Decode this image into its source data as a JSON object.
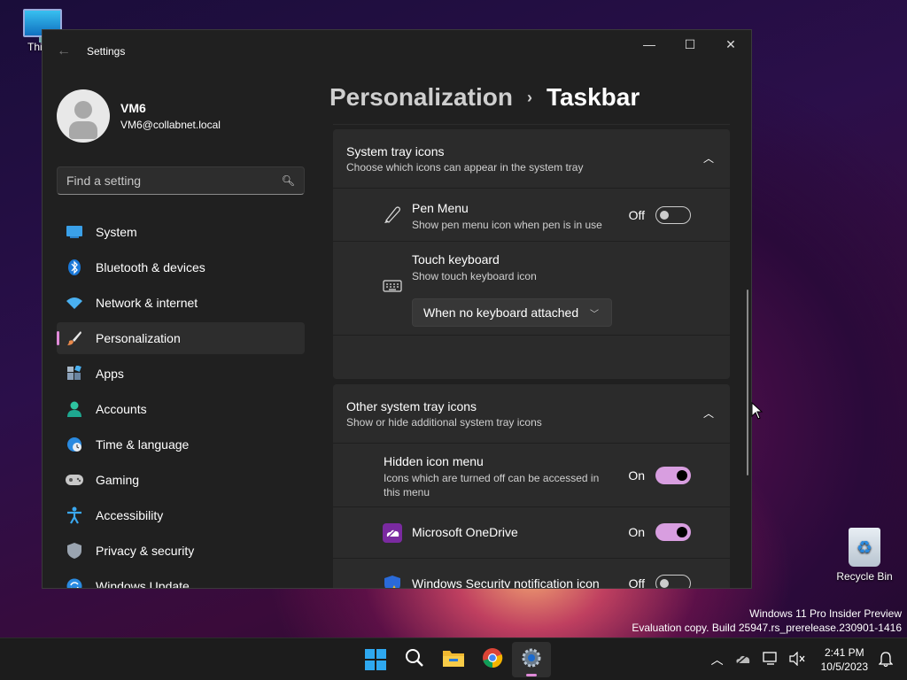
{
  "desktop": {
    "this_pc_label": "This P",
    "recycle_bin_label": "Recycle Bin",
    "watermark_line1": "Windows 11 Pro Insider Preview",
    "watermark_line2": "Evaluation copy. Build 25947.rs_prerelease.230901-1416"
  },
  "window": {
    "title": "Settings",
    "controls": {
      "minimize": "—",
      "maximize": "☐",
      "close": "✕"
    }
  },
  "profile": {
    "name": "VM6",
    "email": "VM6@collabnet.local"
  },
  "search": {
    "placeholder": "Find a setting"
  },
  "nav": [
    {
      "label": "System",
      "icon": "system-icon"
    },
    {
      "label": "Bluetooth & devices",
      "icon": "bluetooth-icon"
    },
    {
      "label": "Network & internet",
      "icon": "wifi-icon"
    },
    {
      "label": "Personalization",
      "icon": "brush-icon",
      "active": true
    },
    {
      "label": "Apps",
      "icon": "apps-icon"
    },
    {
      "label": "Accounts",
      "icon": "accounts-icon"
    },
    {
      "label": "Time & language",
      "icon": "globe-clock-icon"
    },
    {
      "label": "Gaming",
      "icon": "gamepad-icon"
    },
    {
      "label": "Accessibility",
      "icon": "accessibility-icon"
    },
    {
      "label": "Privacy & security",
      "icon": "shield-icon"
    },
    {
      "label": "Windows Update",
      "icon": "update-icon"
    }
  ],
  "breadcrumb": {
    "parent": "Personalization",
    "separator": "›",
    "current": "Taskbar"
  },
  "system_tray": {
    "title": "System tray icons",
    "subtitle": "Choose which icons can appear in the system tray",
    "pen_menu": {
      "title": "Pen Menu",
      "subtitle": "Show pen menu icon when pen is in use",
      "state": "Off"
    },
    "touch_keyboard": {
      "title": "Touch keyboard",
      "subtitle": "Show touch keyboard icon",
      "dropdown_value": "When no keyboard attached"
    }
  },
  "other_tray": {
    "title": "Other system tray icons",
    "subtitle": "Show or hide additional system tray icons",
    "hidden_menu": {
      "title": "Hidden icon menu",
      "subtitle": "Icons which are turned off can be accessed in this menu",
      "state": "On"
    },
    "onedrive": {
      "title": "Microsoft OneDrive",
      "state": "On"
    },
    "security": {
      "title": "Windows Security notification icon",
      "state": "Off"
    }
  },
  "taskbar": {
    "apps": [
      "start-icon",
      "search-icon",
      "file-explorer-icon",
      "chrome-icon",
      "settings-icon"
    ],
    "time": "2:41 PM",
    "date": "10/5/2023"
  },
  "colors": {
    "accent": "#d89ee0",
    "window_bg": "#202020",
    "card_bg": "#2b2b2b"
  }
}
